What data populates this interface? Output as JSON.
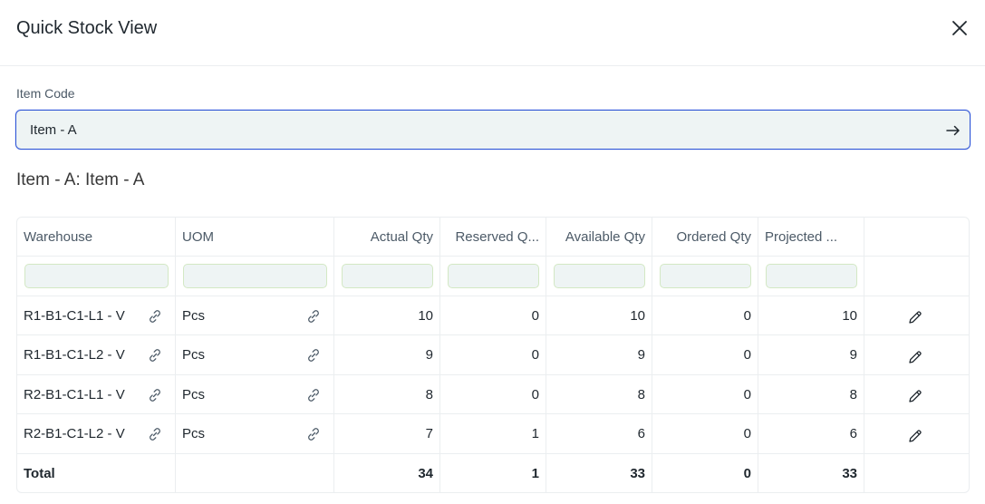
{
  "dialog": {
    "title": "Quick Stock View",
    "item_code_label": "Item Code",
    "item_code_value": "Item - A",
    "item_heading": "Item - A: Item - A"
  },
  "table": {
    "columns": [
      "Warehouse",
      "UOM",
      "Actual Qty",
      "Reserved Q...",
      "Available Qty",
      "Ordered Qty",
      "Projected ..."
    ],
    "rows": [
      {
        "warehouse": "R1-B1-C1-L1 - V",
        "uom": "Pcs",
        "actual": "10",
        "reserved": "0",
        "available": "10",
        "ordered": "0",
        "projected": "10"
      },
      {
        "warehouse": "R1-B1-C1-L2 - V",
        "uom": "Pcs",
        "actual": "9",
        "reserved": "0",
        "available": "9",
        "ordered": "0",
        "projected": "9"
      },
      {
        "warehouse": "R2-B1-C1-L1 - V",
        "uom": "Pcs",
        "actual": "8",
        "reserved": "0",
        "available": "8",
        "ordered": "0",
        "projected": "8"
      },
      {
        "warehouse": "R2-B1-C1-L2 - V",
        "uom": "Pcs",
        "actual": "7",
        "reserved": "1",
        "available": "6",
        "ordered": "0",
        "projected": "6"
      }
    ],
    "total": {
      "label": "Total",
      "actual": "34",
      "reserved": "1",
      "available": "33",
      "ordered": "0",
      "projected": "33"
    }
  },
  "icons": {
    "close": "close-icon",
    "go": "arrow-right-icon",
    "link": "link-icon",
    "edit": "pencil-icon"
  },
  "colors": {
    "input_border": "#2f55d4",
    "input_bg": "#eef4f4",
    "filter_border": "#d3e8c4"
  }
}
